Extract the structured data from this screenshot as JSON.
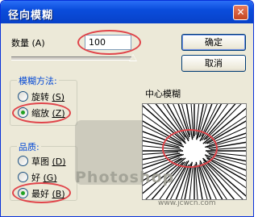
{
  "window": {
    "title": "径向模糊",
    "close_glyph": "✕"
  },
  "amount": {
    "label": "数量",
    "hotkey": "(A)",
    "value": "100",
    "slider_percent": 100
  },
  "buttons": {
    "ok": "确定",
    "cancel": "取消"
  },
  "blur_method": {
    "legend": "模糊方法:",
    "options": [
      {
        "label": "旋转",
        "hotkey": "(S)",
        "checked": false
      },
      {
        "label": "缩放",
        "hotkey": "(Z)",
        "checked": true
      }
    ]
  },
  "quality": {
    "legend": "品质:",
    "options": [
      {
        "label": "草图",
        "hotkey": "(D)",
        "checked": false
      },
      {
        "label": "好",
        "hotkey": "(G)",
        "checked": false
      },
      {
        "label": "最好",
        "hotkey": "(B)",
        "checked": true
      }
    ]
  },
  "preview": {
    "title": "中心模糊"
  },
  "watermark": {
    "text": "Photoshop",
    "site": "www.jcwcn.com"
  },
  "colors": {
    "title_bar": "#0a4ddc",
    "legend_text": "#0046d5",
    "annotation_red": "#e0444a",
    "radio_dot": "#21a121"
  }
}
